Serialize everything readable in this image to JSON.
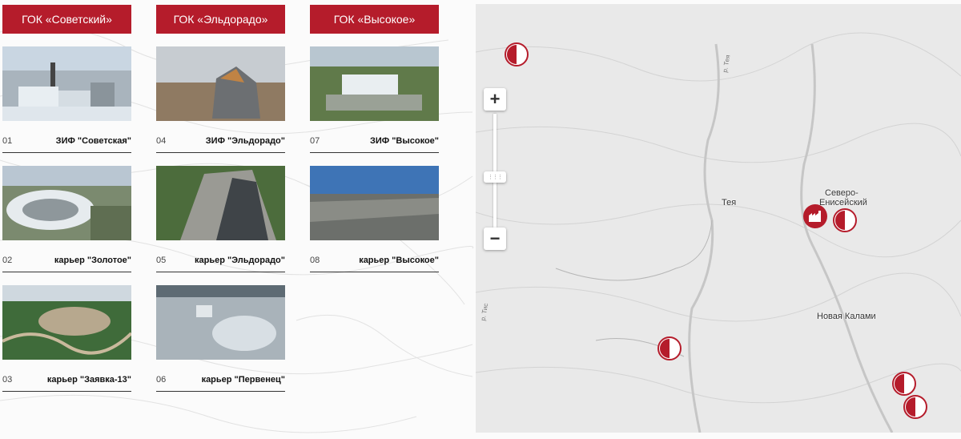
{
  "columns": [
    {
      "tab": "ГОК «Советский»",
      "cards": [
        {
          "num": "01",
          "title": "ЗИФ \"Советская\""
        },
        {
          "num": "02",
          "title": "карьер \"Золотое\""
        },
        {
          "num": "03",
          "title": "карьер \"Заявка-13\""
        }
      ]
    },
    {
      "tab": "ГОК «Эльдорадо»",
      "cards": [
        {
          "num": "04",
          "title": "ЗИФ \"Эльдорадо\""
        },
        {
          "num": "05",
          "title": "карьер \"Эльдорадо\""
        },
        {
          "num": "06",
          "title": "карьер \"Первенец\""
        }
      ]
    },
    {
      "tab": "ГОК «Высокое»",
      "cards": [
        {
          "num": "07",
          "title": "ЗИФ \"Высокое\""
        },
        {
          "num": "08",
          "title": "карьер \"Высокое\""
        }
      ]
    }
  ],
  "map": {
    "zoom_in": "+",
    "zoom_out": "−",
    "places": {
      "teya": "Тея",
      "severo_1": "Северо-",
      "severo_2": "Енисейский",
      "novaya_kalami": "Новая Калами"
    },
    "rivers": {
      "teya": "р. Тея",
      "tis": "р. Тис"
    },
    "marker_icons": [
      "half-circle-marker-icon",
      "factory-marker-icon"
    ],
    "accent": "#b51c2b"
  }
}
